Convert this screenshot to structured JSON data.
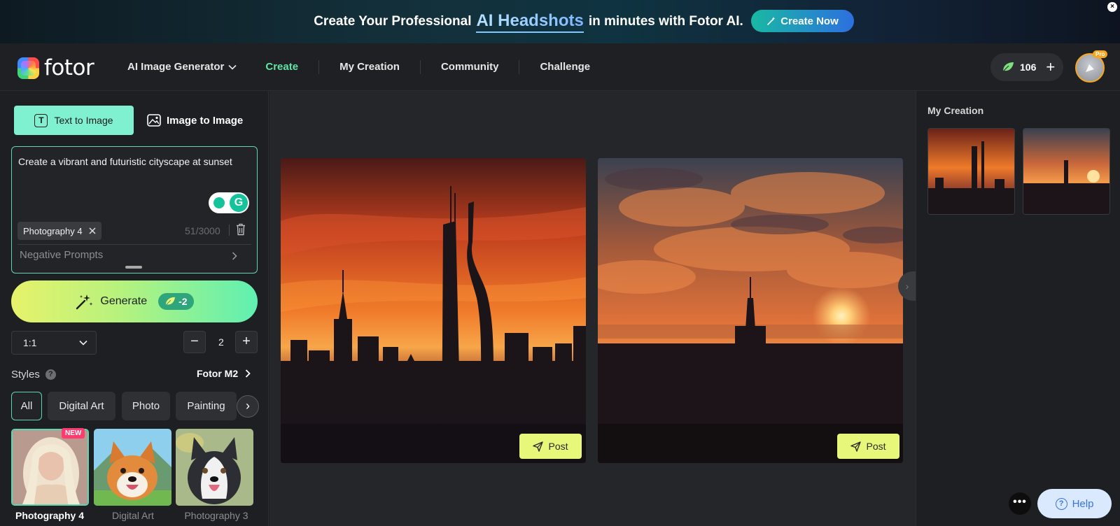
{
  "banner": {
    "text_before": "Create Your Professional",
    "highlight": "AI Headshots",
    "text_after": "in minutes with Fotor AI.",
    "cta_label": "Create Now",
    "close_label": "×"
  },
  "header": {
    "logo_text": "fotor",
    "nav": {
      "dropdown_label": "AI Image Generator",
      "items": [
        "Create",
        "My Creation",
        "Community",
        "Challenge"
      ],
      "active": "Create"
    },
    "credits": "106",
    "plus_label": "+",
    "pro_badge": "Pro"
  },
  "left_panel": {
    "tabs": {
      "text_to_image": "Text to Image",
      "image_to_image": "Image to Image",
      "text_icon_letter": "T"
    },
    "prompt": {
      "value": "Create a vibrant and futuristic cityscape at sunset",
      "style_chip": "Photography 4",
      "char_count": "51/3000",
      "negative_prompts": "Negative Prompts"
    },
    "generate": {
      "label": "Generate",
      "cost": "-2"
    },
    "ratio": "1:1",
    "quantity": {
      "minus": "−",
      "value": "2",
      "plus": "+"
    },
    "styles": {
      "label": "Styles",
      "help": "?",
      "model": "Fotor M2",
      "filters": [
        "All",
        "Digital Art",
        "Photo",
        "Painting"
      ],
      "active_filter": "All",
      "cards": [
        {
          "name": "Photography 4",
          "badge": "NEW",
          "selected": true
        },
        {
          "name": "Digital Art",
          "badge": "",
          "selected": false
        },
        {
          "name": "Photography 3",
          "badge": "",
          "selected": false
        }
      ]
    }
  },
  "results": {
    "post_label": "Post"
  },
  "right_panel": {
    "title": "My Creation"
  },
  "floating": {
    "more_label": "•••",
    "help_label": "Help",
    "help_icon": "?"
  },
  "colors": {
    "accent": "#5fe3a8",
    "post_button": "#e7f77a",
    "banner_cta_start": "#19b9a3",
    "banner_cta_end": "#2d6fe0",
    "pro_badge": "#f5a623",
    "new_badge": "#ff3c6f"
  },
  "icons": {
    "logo": "fotor-logo",
    "dropdown": "chevron-down-icon",
    "credits": "leaf-icon",
    "generate": "magic-wand-icon",
    "delete": "trash-icon",
    "post": "send-icon",
    "help": "question-circle-icon"
  }
}
